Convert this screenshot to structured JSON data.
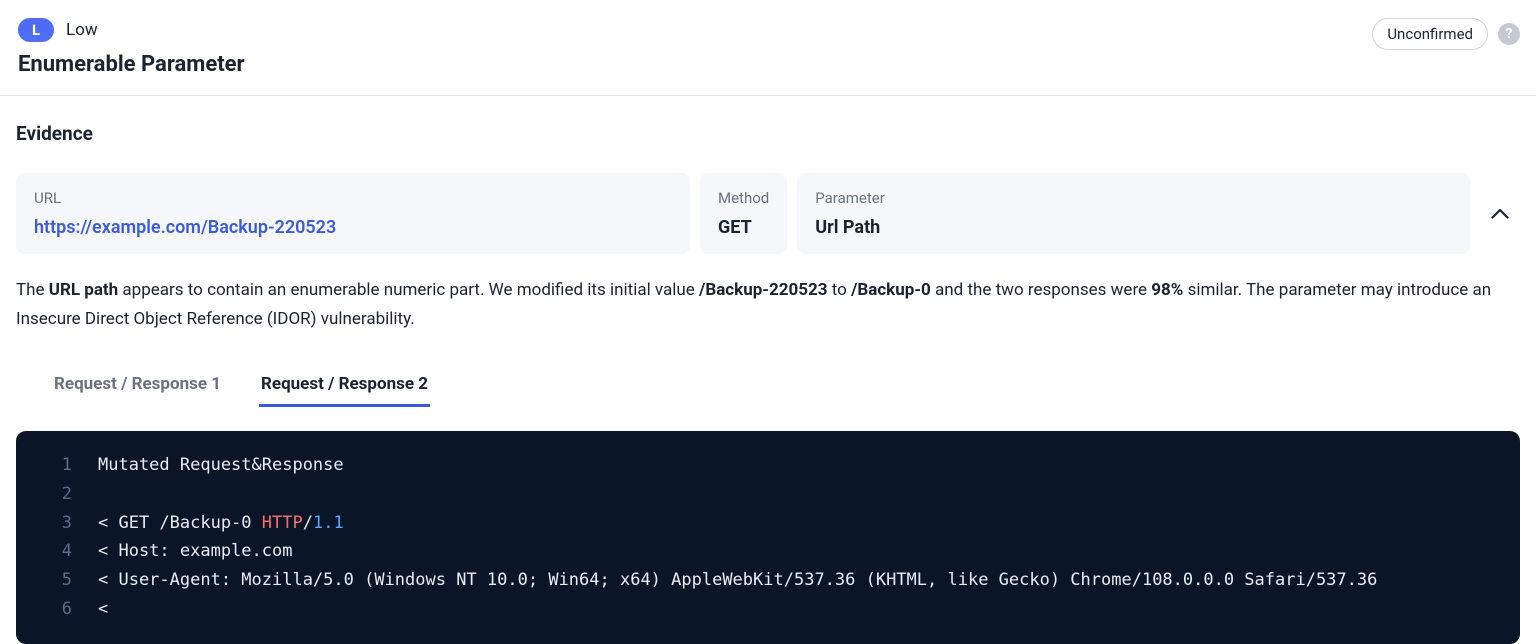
{
  "severity": {
    "badge_letter": "L",
    "label": "Low"
  },
  "title": "Enumerable Parameter",
  "status": "Unconfirmed",
  "section_heading": "Evidence",
  "info": {
    "url_label": "URL",
    "url_value": "https://example.com/Backup-220523",
    "method_label": "Method",
    "method_value": "GET",
    "param_label": "Parameter",
    "param_value": "Url Path"
  },
  "description": {
    "pre": "The ",
    "strong1": "URL path",
    "mid1": " appears to contain an enumerable numeric part. We modified its initial value ",
    "strong2": "/Backup-220523",
    "mid2": " to ",
    "strong3": "/Backup-0",
    "mid3": " and the two responses were ",
    "strong4": "98%",
    "post": " similar. The parameter may introduce an Insecure Direct Object Reference (IDOR) vulnerability."
  },
  "tabs": {
    "t1": "Request / Response 1",
    "t2": "Request / Response 2"
  },
  "code": {
    "l1": "Mutated Request&Response",
    "l2": "",
    "l3_a": "< GET /Backup-0 ",
    "l3_http": "HTTP",
    "l3_slash": "/",
    "l3_ver": "1.1",
    "l4": "< Host: example.com",
    "l5": "< User-Agent: Mozilla/5.0 (Windows NT 10.0; Win64; x64) AppleWebKit/537.36 (KHTML, like Gecko) Chrome/108.0.0.0 Safari/537.36",
    "l6": "<",
    "nums": {
      "n1": "1",
      "n2": "2",
      "n3": "3",
      "n4": "4",
      "n5": "5",
      "n6": "6"
    }
  }
}
